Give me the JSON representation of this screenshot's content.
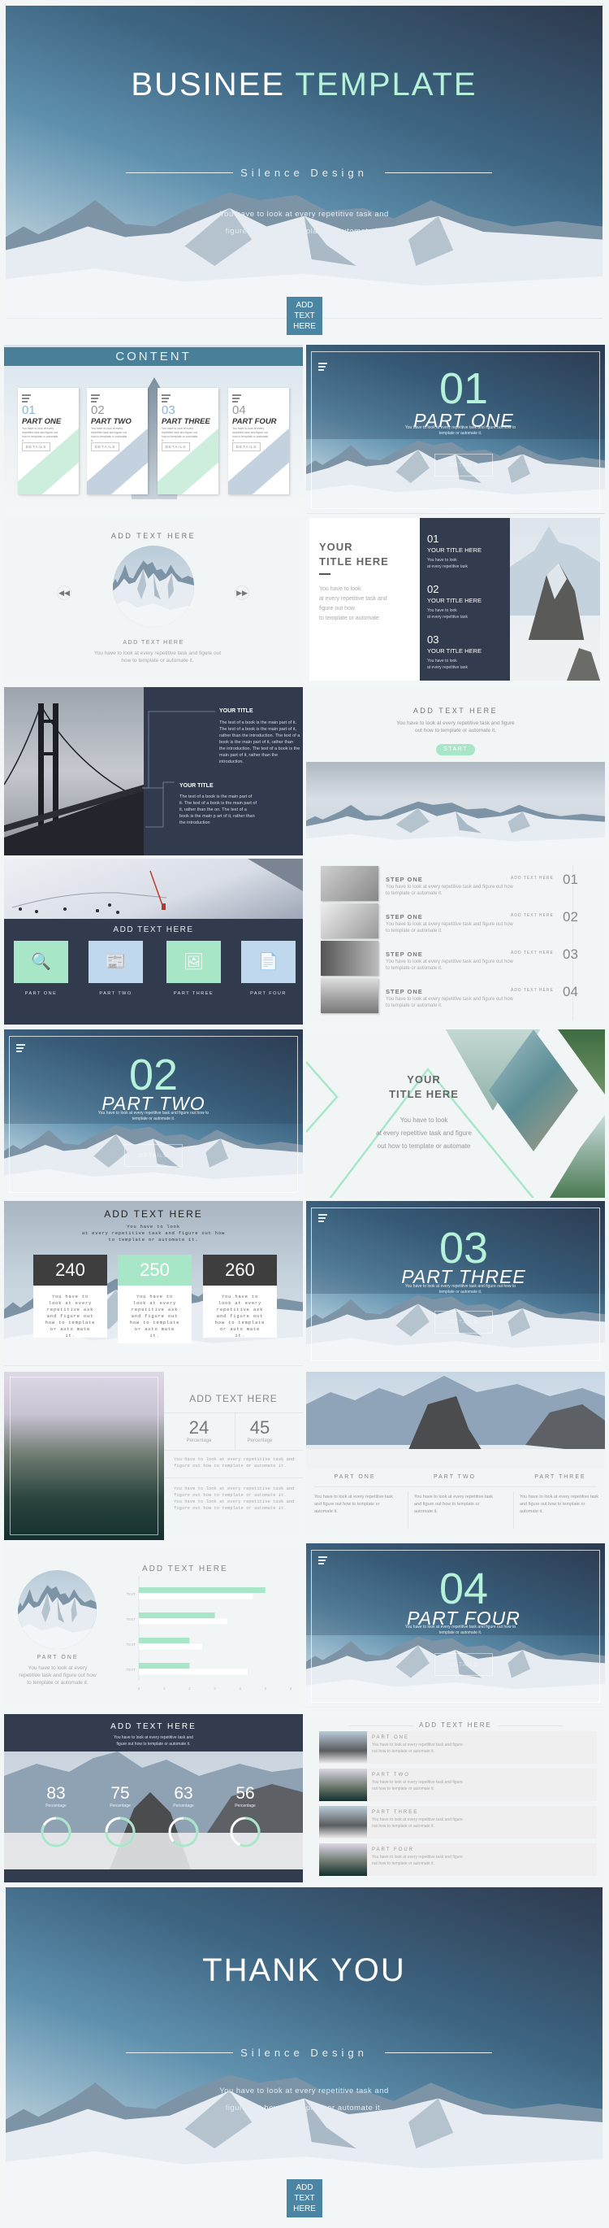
{
  "colors": {
    "navy": "#323c4e",
    "mint": "#a8e6c8",
    "blue_tag": "#4a86a3",
    "light_blue": "#c0d8ee",
    "accent_title": "#b5f2d9"
  },
  "cover": {
    "title_a": "BUSINEE",
    "title_b": "TEMPLATE",
    "subtitle": "Silence Design",
    "body_1": "You have to look at every repetitive task and",
    "body_2": "figure out how to template or automate it.",
    "tag": "ADD TEXT HERE"
  },
  "contents": {
    "heading": "CONTENT",
    "cards": [
      {
        "num": "01",
        "title": "PART ONE",
        "body": "You have to look at every repetitive task and figure out how to template or automate it.",
        "button": "DETAILS"
      },
      {
        "num": "02",
        "title": "PART TWO",
        "body": "You have to look at every repetitive task and figure out how to template or automate it.",
        "button": "DETAILS"
      },
      {
        "num": "03",
        "title": "PART THREE",
        "body": "You have to look at every repetitive task and figure out how to template or automate it.",
        "button": "DETAILS"
      },
      {
        "num": "04",
        "title": "PART FOUR",
        "body": "You have to look at every repetitive task and figure out how to template or automate it.",
        "button": "DETAILS"
      }
    ]
  },
  "sections": [
    {
      "num": "01",
      "title": "PART ONE",
      "body": "You have to look at every repetitive task and figure out how to template or automate it.",
      "button": "DETAILS"
    },
    {
      "num": "02",
      "title": "PART TWO",
      "body": "You have to look at every repetitive task and figure out how to template or automate it.",
      "button": "DETAILS"
    },
    {
      "num": "03",
      "title": "PART THREE",
      "body": "You have to look at every repetitive task and figure out how to template or automate it.",
      "button": "DETAILS"
    },
    {
      "num": "04",
      "title": "PART FOUR",
      "body": "You have to look at every repetitive task and figure out how to template or automate it.",
      "button": "DETAILS"
    }
  ],
  "carousel": {
    "heading": "ADD TEXT HERE",
    "caption": "ADD TEXT HERE",
    "body": "You have to look at every repetitive task and figure out how to template or automate it.",
    "prev_icon": "rewind-icon",
    "next_icon": "fast-forward-icon"
  },
  "title_list": {
    "title_1": "YOUR",
    "title_2": "TITLE HERE",
    "body": [
      "You have to look",
      "at every repetitive task and",
      "figure out how",
      "to template or automate"
    ],
    "items": [
      {
        "num": "01",
        "title": "YOUR TITLE HERE",
        "body_1": "You have to look",
        "body_2": "at every repetitive task"
      },
      {
        "num": "02",
        "title": "YOUR TITLE HERE",
        "body_1": "You have to look",
        "body_2": "at every repetitive task"
      },
      {
        "num": "03",
        "title": "YOUR TITLE HERE",
        "body_1": "You have to look",
        "body_2": "at every repetitive task"
      }
    ]
  },
  "bridge": {
    "blocks": [
      {
        "title": "YOUR TITLE",
        "body": "The text of a book is the main part of it. The text of a book is the main part of it, rather than the introduction. The text of a book is the main part of it, rather than the introduction. The text of a book is the main part of it, rather than the introduction."
      },
      {
        "title": "YOUR TITLE",
        "body": "The text of a book is the main part of it. The text of a book is the main part of it, rather than the on. The text of a book is the main p art of it, rather than the introduction"
      }
    ]
  },
  "start": {
    "heading": "ADD TEXT HERE",
    "body_1": "You have to look at every repetitive task and figure",
    "body_2": "out how to template or automate it.",
    "button": "START"
  },
  "icon_tiles": {
    "heading": "ADD TEXT HERE",
    "items": [
      {
        "label": "PART ONE",
        "icon": "document-search-icon",
        "color": "#a8e6c8"
      },
      {
        "label": "PART TWO",
        "icon": "newspaper-icon",
        "color": "#c0d8ee"
      },
      {
        "label": "PART THREE",
        "icon": "image-gallery-icon",
        "color": "#a8e6c8"
      },
      {
        "label": "PART FOUR",
        "icon": "documents-icon",
        "color": "#c0d8ee"
      }
    ]
  },
  "steps": {
    "items": [
      {
        "title": "STEP ONE",
        "body": "You have to look at every repetitive task and figure out how to template or automate it.",
        "tag": "ADD TEXT HERE",
        "num": "01"
      },
      {
        "title": "STEP ONE",
        "body": "You have to look at every repetitive task and figure out how to template or automate it.",
        "tag": "ADD TEXT HERE",
        "num": "02"
      },
      {
        "title": "STEP ONE",
        "body": "You have to look at every repetitive task and figure out how to template or automate it.",
        "tag": "ADD TEXT HERE",
        "num": "03"
      },
      {
        "title": "STEP ONE",
        "body": "You have to look at every repetitive task and figure out how to template or automate it.",
        "tag": "ADD TEXT HERE",
        "num": "04"
      }
    ]
  },
  "triangle": {
    "title_1": "YOUR",
    "title_2": "TITLE HERE",
    "body": [
      "You have to look",
      "at every repetitive task and figure",
      "out how to template or automate"
    ]
  },
  "pricing": {
    "heading": "ADD TEXT HERE",
    "body": [
      "You have to look",
      "at every repetitive task and figure out how",
      "to template or automate it."
    ],
    "cards": [
      {
        "value": "240",
        "body": "You have to look at every repetitive ask and figure out how to template or auto mate it."
      },
      {
        "value": "250",
        "body": "You have to look at every repetitive ask and figure out how to template or auto mate it."
      },
      {
        "value": "260",
        "body": "You have to look at every repetitive ask and figure out how to template or auto mate it."
      }
    ]
  },
  "stats": {
    "heading": "ADD TEXT HERE",
    "items": [
      {
        "value": "24",
        "label": "Percentage"
      },
      {
        "value": "45",
        "label": "Percentage"
      }
    ],
    "body_1": "You have to look at every repetitive task and figure out how to template or automate it.",
    "body_2": "You have to look at every repetitive task and figure out how to template or automate it. You have to look at every repetitive task and figure out how to template or automate it."
  },
  "three_parts": {
    "parts": [
      {
        "title": "PART ONE",
        "body": "You have to look at every repetitive task and figure out how to template or automate it."
      },
      {
        "title": "PART TWO",
        "body": "You have to look at every repetitive task and figure out how to template or automate it."
      },
      {
        "title": "PART THREE",
        "body": "You have to look at every repetitive task and figure out how to template or automate it."
      }
    ]
  },
  "bar_slide": {
    "heading": "ADD TEXT HERE",
    "part": "PART ONE",
    "body": "You have to look at every repetitive task and figure out how to template or automate it."
  },
  "chart_data": {
    "type": "bar",
    "orientation": "horizontal",
    "categories": [
      "TEXT",
      "TEXT",
      "TEXT",
      "TEXT"
    ],
    "series": [
      {
        "values": [
          5,
          3,
          2,
          2
        ],
        "color": "#a8e6c8"
      },
      {
        "values": [
          4.5,
          3.5,
          2.5,
          4.3
        ],
        "color": "#ffffff"
      }
    ],
    "xlim": [
      0,
      6
    ],
    "xticks": [
      "0",
      "1",
      "2",
      "3",
      "4",
      "5",
      "6"
    ],
    "grid": false,
    "title": "",
    "xlabel": "",
    "ylabel": ""
  },
  "rings": {
    "heading": "ADD TEXT HERE",
    "body_1": "You have to look at every repetitive task and",
    "body_2": "figure out how to template or automate it.",
    "items": [
      {
        "value": "83",
        "label": "Percentage",
        "fraction": 0.83
      },
      {
        "value": "75",
        "label": "Percentage",
        "fraction": 0.75
      },
      {
        "value": "63",
        "label": "Percentage",
        "fraction": 0.63
      },
      {
        "value": "56",
        "label": "Percentage",
        "fraction": 0.56
      }
    ]
  },
  "list": {
    "heading": "ADD TEXT HERE",
    "items": [
      {
        "title": "PART ONE",
        "body_1": "You have to look at every repetitive task and figure",
        "body_2": "out how to template or automate it."
      },
      {
        "title": "PART TWO",
        "body_1": "You have to look at every repetitive task and figure",
        "body_2": "out how to template or automate it."
      },
      {
        "title": "PART THREE",
        "body_1": "You have to look at every repetitive task and figure",
        "body_2": "out how to template or automate it."
      },
      {
        "title": "PART FOUR",
        "body_1": "You have to look at every repetitive task and figure",
        "body_2": "out how to template or automate it."
      }
    ]
  },
  "thanks": {
    "title": "THANK YOU",
    "subtitle": "Silence Design",
    "body_1": "You have to look at every repetitive task and",
    "body_2": "figure out how to template or automate it.",
    "tag": "ADD TEXT HERE"
  }
}
